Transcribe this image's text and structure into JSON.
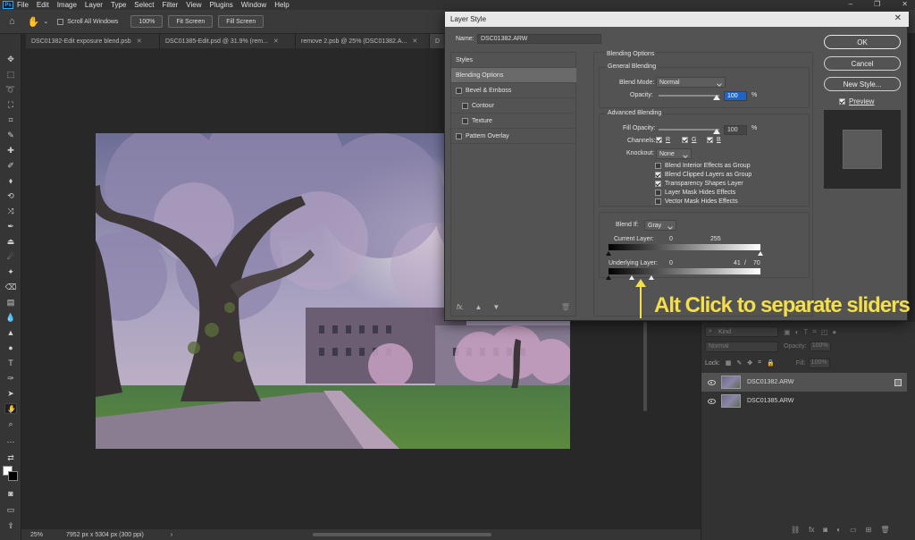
{
  "menubar": {
    "app_icon": "Ps",
    "items": [
      "File",
      "Edit",
      "Image",
      "Layer",
      "Type",
      "Select",
      "Filter",
      "View",
      "Plugins",
      "Window",
      "Help"
    ]
  },
  "options_bar": {
    "scroll_all_windows": "Scroll All Windows",
    "zoom": "100%",
    "fit_screen": "Fit Screen",
    "fill_screen": "Fill Screen"
  },
  "tabs": [
    {
      "label": "DSC01382-Edit exposure blend.psb"
    },
    {
      "label": "DSC01385-Edit.psd @ 31.9% (rem..."
    },
    {
      "label": "remove 2.psb @ 25% (DSC01382.A..."
    },
    {
      "label": "D"
    }
  ],
  "status": {
    "zoom": "25%",
    "doc_info": "7952 px x 5304 px (300 ppi)",
    "arrow": "›"
  },
  "layers_panel": {
    "search_placeholder": "Kind",
    "blend_mode": "Normal",
    "opacity_label": "Opacity:",
    "opacity_value": "100%",
    "lock_label": "Lock:",
    "fill_label": "Fill:",
    "fill_value": "100%",
    "layers": [
      {
        "name": "DSC01382.ARW",
        "selected": true
      },
      {
        "name": "DSC01385.ARW",
        "selected": false
      }
    ]
  },
  "dialog": {
    "title": "Layer Style",
    "name_label": "Name:",
    "name_value": "DSC01382.ARW",
    "styles_header": "Styles",
    "style_items": [
      {
        "label": "Blending Options",
        "checkbox": false,
        "indent": false,
        "active": true
      },
      {
        "label": "Bevel & Emboss",
        "checkbox": true,
        "indent": false,
        "active": false
      },
      {
        "label": "Contour",
        "checkbox": true,
        "indent": true,
        "active": false
      },
      {
        "label": "Texture",
        "checkbox": true,
        "indent": true,
        "active": false
      },
      {
        "label": "Pattern Overlay",
        "checkbox": true,
        "indent": false,
        "active": false
      }
    ],
    "fx": "fx.",
    "buttons": {
      "ok": "OK",
      "cancel": "Cancel",
      "new_style": "New Style...",
      "preview": "Preview"
    },
    "blending_options_title": "Blending Options",
    "general_blending": "General Blending",
    "blend_mode_label": "Blend Mode:",
    "blend_mode_value": "Normal",
    "opacity_label": "Opacity:",
    "opacity_value": "100",
    "percent": "%",
    "advanced_blending": "Advanced Blending",
    "fill_opacity_label": "Fill Opacity:",
    "fill_opacity_value": "100",
    "channels_label": "Channels:",
    "channels": [
      "R",
      "G",
      "B"
    ],
    "knockout_label": "Knockout:",
    "knockout_value": "None",
    "adv_checks": [
      {
        "label": "Blend Interior Effects as Group",
        "checked": false
      },
      {
        "label": "Blend Clipped Layers as Group",
        "checked": true
      },
      {
        "label": "Transparency Shapes Layer",
        "checked": true
      },
      {
        "label": "Layer Mask Hides Effects",
        "checked": false
      },
      {
        "label": "Vector Mask Hides Effects",
        "checked": false
      }
    ],
    "blend_if_label": "Blend If:",
    "blend_if_value": "Gray",
    "current_layer_label": "Current Layer:",
    "current_layer_low": "0",
    "current_layer_high": "255",
    "underlying_layer_label": "Underlying Layer:",
    "underlying_low": "0",
    "underlying_split_a": "41",
    "underlying_slash": "/",
    "underlying_split_b": "70"
  },
  "annotation": {
    "text": "Alt Click to separate sliders",
    "color": "#f4df4a"
  }
}
